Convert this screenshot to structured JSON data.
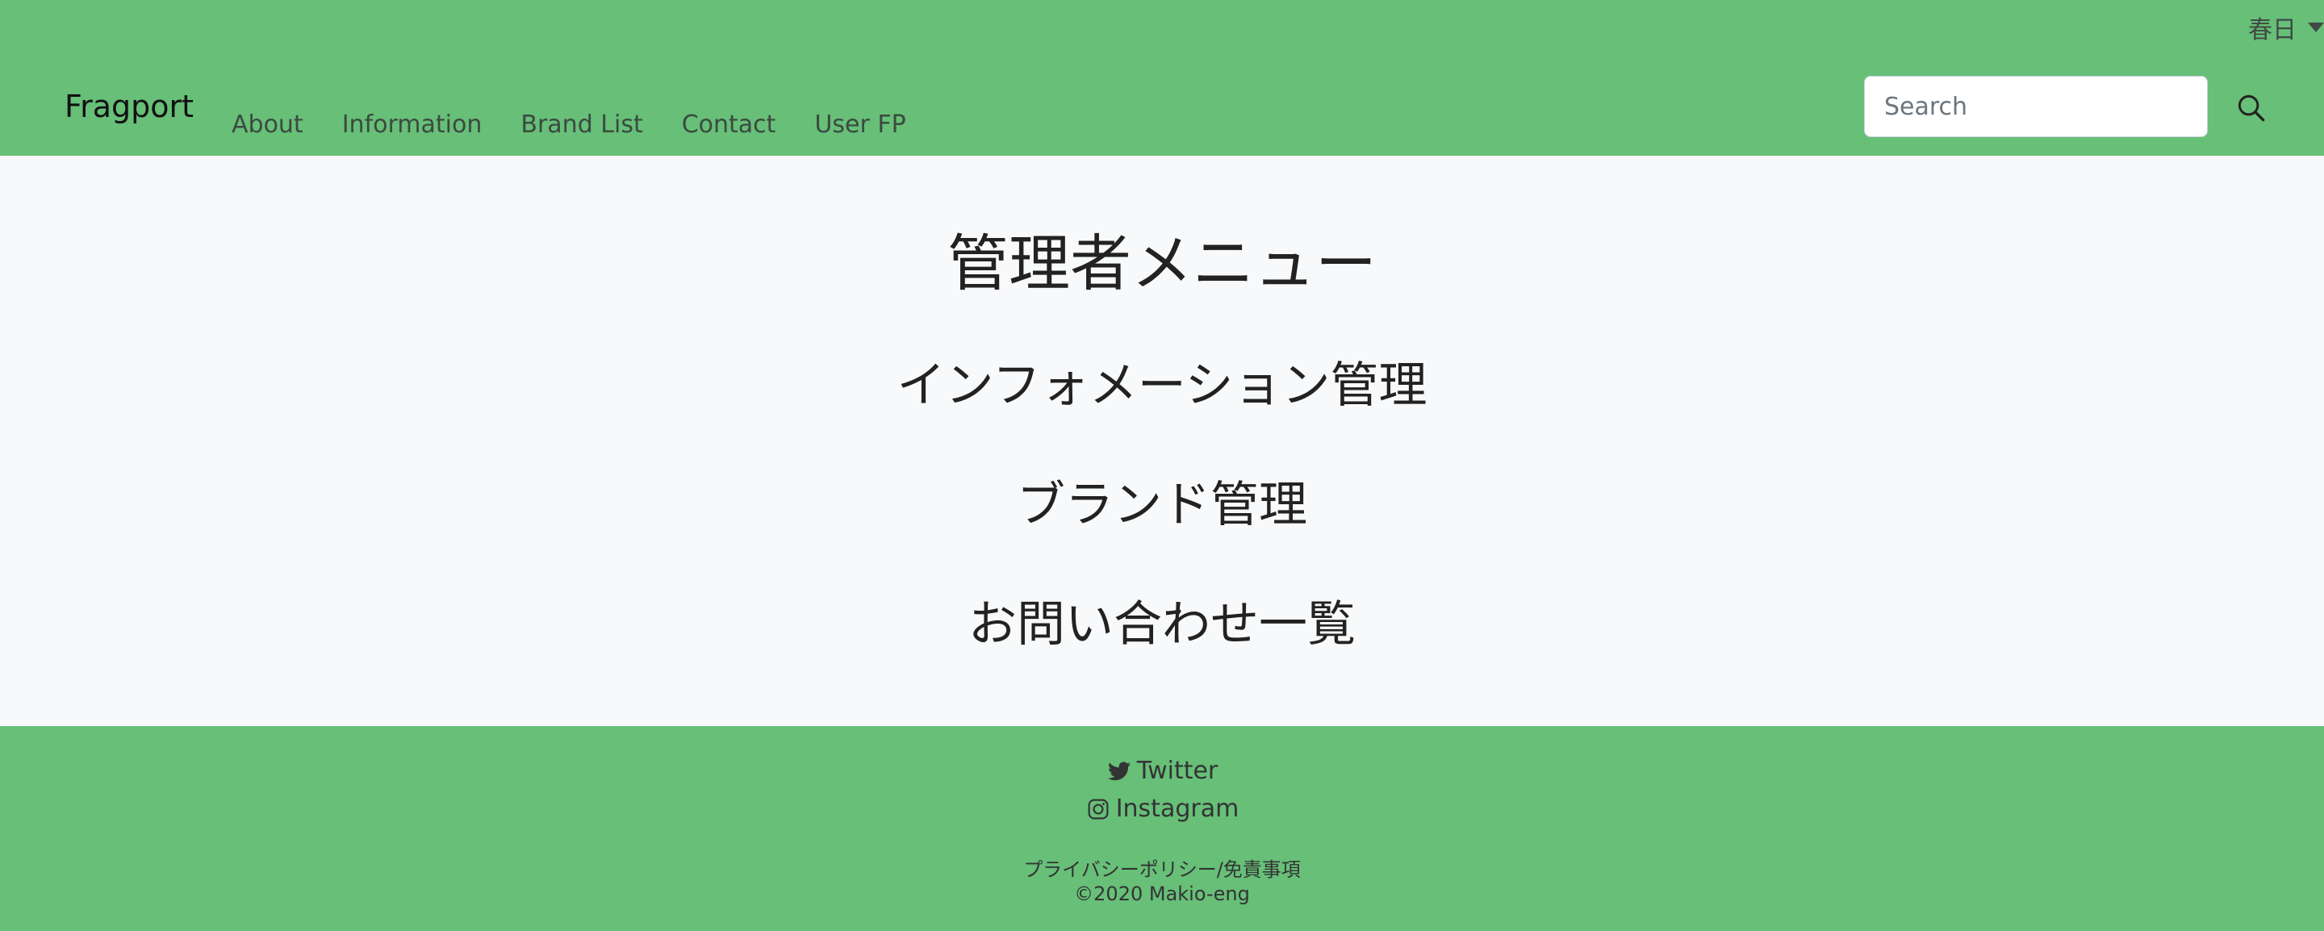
{
  "header": {
    "user_name": "春日",
    "brand": "Fragport",
    "nav": [
      "About",
      "Information",
      "Brand List",
      "Contact",
      "User FP"
    ],
    "search_placeholder": "Search"
  },
  "main": {
    "title": "管理者メニュー",
    "links": [
      "インフォメーション管理",
      "ブランド管理",
      "お問い合わせ一覧"
    ]
  },
  "footer": {
    "twitter": "Twitter",
    "instagram": "Instagram",
    "policy": "プライバシーポリシー/免責事項",
    "copyright": "©2020 Makio-eng"
  },
  "colors": {
    "header_bg": "#67bf78",
    "footer_bg": "#67bf78",
    "main_bg": "#f8f9fa"
  }
}
